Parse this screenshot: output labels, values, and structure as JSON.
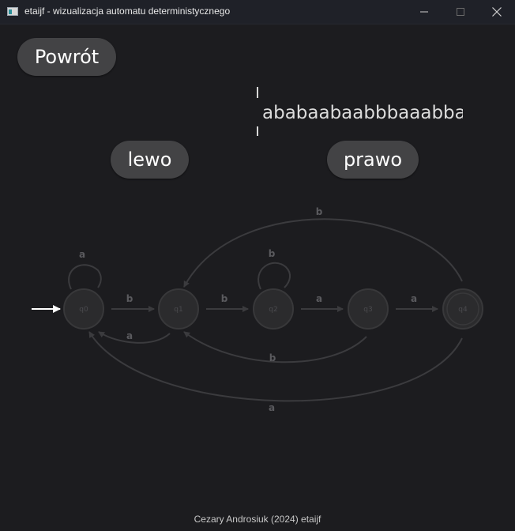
{
  "window": {
    "title": "etaijf - wizualizacja automatu deterministycznego"
  },
  "controls": {
    "back_label": "Powrót",
    "left_label": "lewo",
    "right_label": "prawo"
  },
  "tape": {
    "text": "ababaabaabbbaaabbaa"
  },
  "automaton": {
    "states": [
      {
        "id": "q0",
        "initial": true,
        "accepting": false
      },
      {
        "id": "q1",
        "initial": false,
        "accepting": false
      },
      {
        "id": "q2",
        "initial": false,
        "accepting": false
      },
      {
        "id": "q3",
        "initial": false,
        "accepting": false
      },
      {
        "id": "q4",
        "initial": false,
        "accepting": true
      }
    ],
    "transitions": [
      {
        "from": "q0",
        "to": "q0",
        "symbol": "a"
      },
      {
        "from": "q0",
        "to": "q1",
        "symbol": "b"
      },
      {
        "from": "q1",
        "to": "q0",
        "symbol": "a"
      },
      {
        "from": "q1",
        "to": "q2",
        "symbol": "b"
      },
      {
        "from": "q2",
        "to": "q2",
        "symbol": "b"
      },
      {
        "from": "q2",
        "to": "q3",
        "symbol": "a"
      },
      {
        "from": "q3",
        "to": "q1",
        "symbol": "b"
      },
      {
        "from": "q3",
        "to": "q4",
        "symbol": "a"
      },
      {
        "from": "q4",
        "to": "q1",
        "symbol": "b"
      },
      {
        "from": "q4",
        "to": "q0",
        "symbol": "a"
      }
    ],
    "colors": {
      "state_fill": "#2b2b2d",
      "state_stroke": "#38383a",
      "edge": "#3b3b3e",
      "label": "#5a5a5e",
      "start_arrow": "#ffffff"
    }
  },
  "footer": {
    "credit": "Cezary Androsiuk (2024) etaijf"
  }
}
